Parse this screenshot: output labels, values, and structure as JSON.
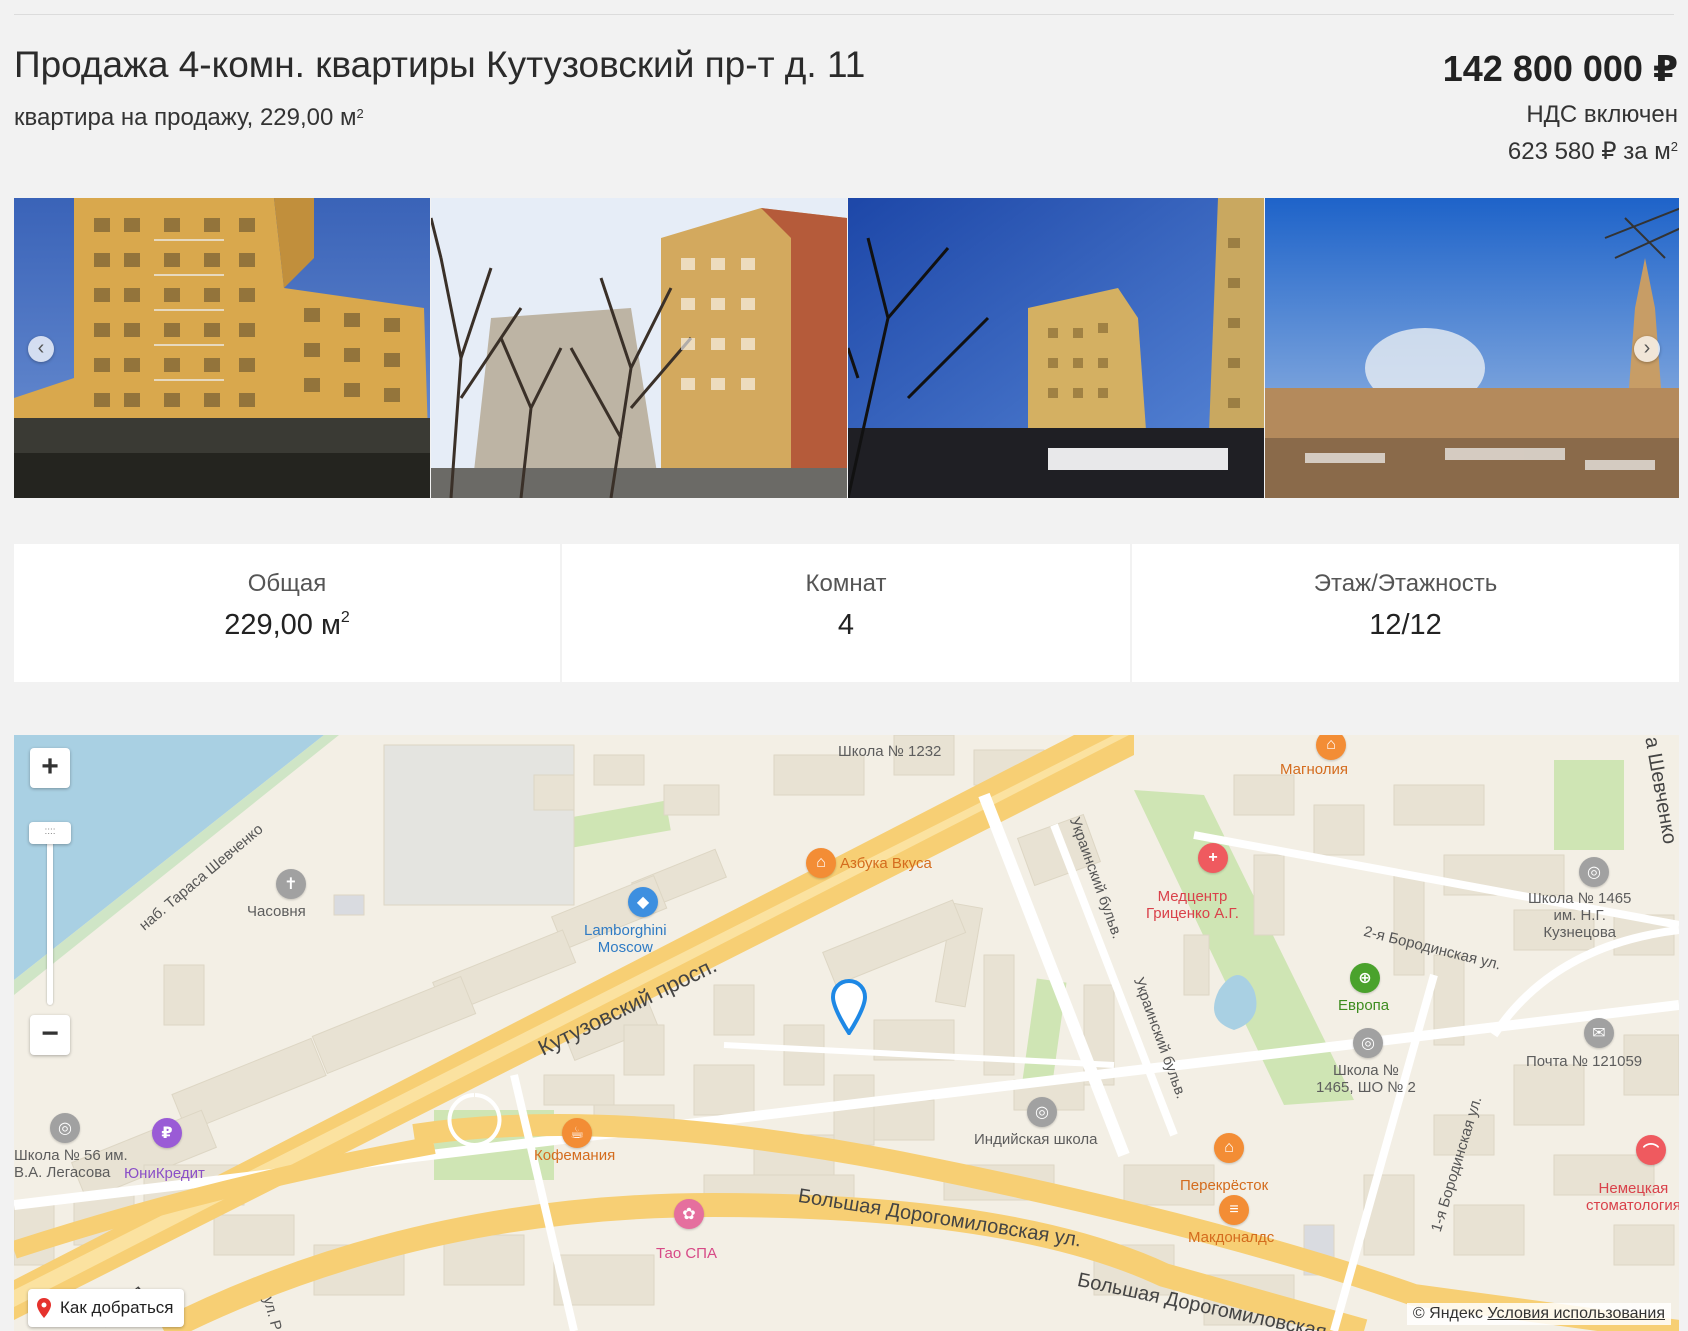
{
  "listing": {
    "title": "Продажа 4-комн. квартиры Кутузовский пр-т д. 11",
    "subtitle": "квартира на продажу, 229,00 м",
    "subtitle_sup": "2",
    "price": "142 800 000 ₽",
    "vat": "НДС включен",
    "price_per_m": "623 580 ₽ за м",
    "price_per_m_sup": "2"
  },
  "gallery": {
    "prev_icon": "‹",
    "next_icon": "›"
  },
  "stats": [
    {
      "label": "Общая",
      "value": "229,00 м",
      "sup": "2"
    },
    {
      "label": "Комнат",
      "value": "4",
      "sup": ""
    },
    {
      "label": "Этаж/Этажность",
      "value": "12/12",
      "sup": ""
    }
  ],
  "map": {
    "zoom_in": "+",
    "zoom_out": "−",
    "zoom_handle": "::::",
    "route_button": "Как добраться",
    "copyright": "© Яндекс",
    "terms": "Условия использования",
    "streets": {
      "kutuzovsky": "Кутузовский просп.",
      "embankment": "наб. Тараса Шевченко",
      "ukrainsky1": "Украинский бульв.",
      "ukrainsky2": "Украинский бульв.",
      "borodinskaya2": "2-я Бородинская ул.",
      "borodinskaya1": "1-я Бородинская ул.",
      "dorogomilovskaya1": "Большая Дорогомиловская ул.",
      "dorogomilovskaya2": "Большая Дорогомиловская",
      "shevchenko_edge": "а Шевченко",
      "prosp_edge": "просп.",
      "ul_edge": "ул. Р"
    },
    "pois": {
      "school1232": "Школа № 1232",
      "magnolia": "Магнолия",
      "azbuka": "Азбука Вкуса",
      "chasovnya": "Часовня",
      "lamborghini": "Lamborghini\nMoscow",
      "medcenter": "Медцентр\nГриценко А.Г.",
      "school1465": "Школа № 1465\nим. Н.Г.\nКузнецова",
      "evropa": "Европа",
      "school1465b": "Школа №\n1465, ШО № 2",
      "pochta": "Почта № 121059",
      "school56": "Школа № 56 им.\nВ.А. Легасова",
      "unicredit": "ЮниКредит",
      "kofemania": "Кофемания",
      "indian_school": "Индийская школа",
      "perekrestok": "Перекрёсток",
      "mcdonalds": "Макдоналдс",
      "tao_spa": "Тао СПА",
      "dental": "Немецкая\nстоматология"
    }
  }
}
